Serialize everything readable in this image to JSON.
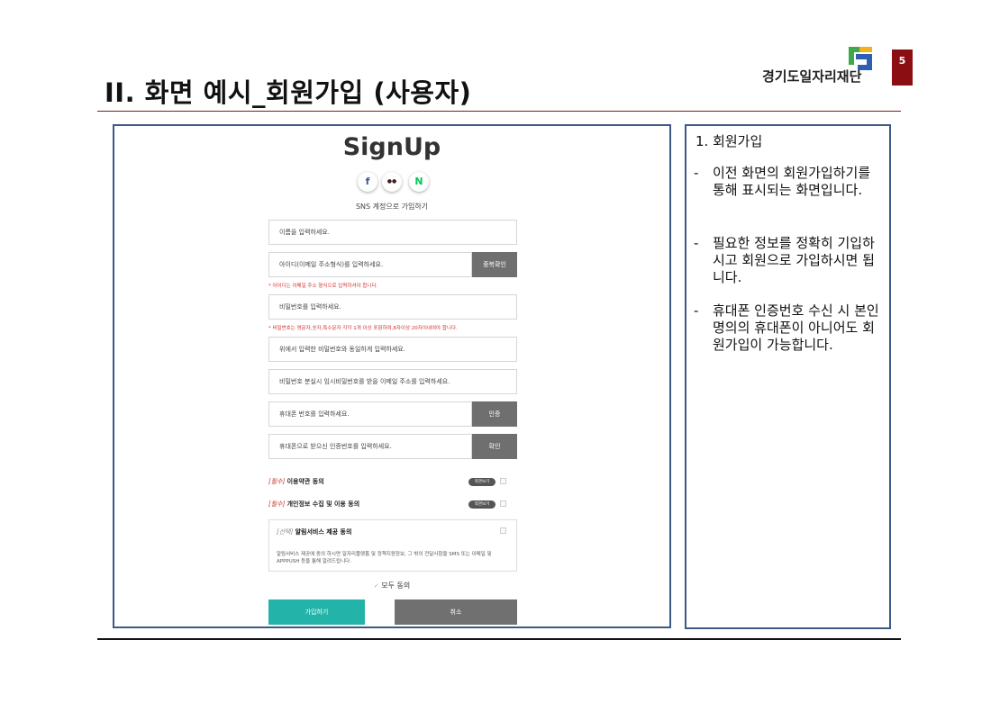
{
  "slide": {
    "title": "II. 화면 예시_회원가입 (사용자)",
    "logo_text": "경기도일자리재단",
    "page_number": "5",
    "accent_color": "#8b0f12",
    "frame_color": "#3b5a86"
  },
  "mockup": {
    "title": "SignUp",
    "sns_icons": [
      {
        "name": "facebook-icon",
        "glyph": "f",
        "color": "#3b5998"
      },
      {
        "name": "kakao-icon",
        "glyph": "●●",
        "color": "#3c1e1e"
      },
      {
        "name": "naver-icon",
        "glyph": "N",
        "color": "#03c75a"
      }
    ],
    "sns_caption": "SNS 계정으로 가입하기",
    "fields": {
      "name_placeholder": "이름을 입력하세요.",
      "id_placeholder": "아이디(이메일 주소형식)를 입력하세요.",
      "id_check_button": "중복확인",
      "id_hint": "* 아이디는 이메일 주소 형식으로 입력하셔야 합니다.",
      "password_placeholder": "비밀번호를 입력하세요.",
      "password_hint": "* 비밀번호는 영문자,숫자,특수문자 각각 1개 이상 포함하여,8자이상 20자이내여야 합니다.",
      "password_confirm_placeholder": "위에서 입력한 비밀번호와 동일하게 입력하세요.",
      "recovery_email_placeholder": "비밀번호 분실시 임시비밀번호를 받을 이메일 주소를 입력하세요.",
      "phone_placeholder": "휴대폰 번호를 입력하세요.",
      "phone_verify_button": "인증",
      "code_placeholder": "휴대폰으로 받으신 인증번호를 입력하세요.",
      "code_confirm_button": "확인"
    },
    "agreements": {
      "terms_tag": "[필수]",
      "terms_label": "이용약관 동의",
      "privacy_tag": "[필수]",
      "privacy_label": "개인정보 수집 및 이용 동의",
      "view_terms": "약관보기",
      "optional_tag": "[선택]",
      "optional_label": "알림서비스 제공 동의",
      "optional_desc": "알림서비스 제공에 동의 하시면 일자리플랫폼 및 정책지원정보, 그 밖의 전달사항을 SMS 또는 이메일 및 APPPUSH 등을 통해 알려드립니다.",
      "agree_all": "모두 동의"
    },
    "buttons": {
      "join": "가입하기",
      "cancel": "취소"
    },
    "colors": {
      "join_button": "#24b3a8",
      "gray_button": "#6f6f6f",
      "required_tag": "#c0392b"
    }
  },
  "description": {
    "heading": "1.  회원가입",
    "bullets": [
      "이전 화면의 회원가입하기를 통해 표시되는 화면입니다.",
      "필요한 정보를 정확히 기입하시고 회원으로 가입하시면 됩니다.",
      "휴대폰 인증번호 수신 시 본인명의의 휴대폰이 아니어도 회원가입이 가능합니다."
    ]
  }
}
